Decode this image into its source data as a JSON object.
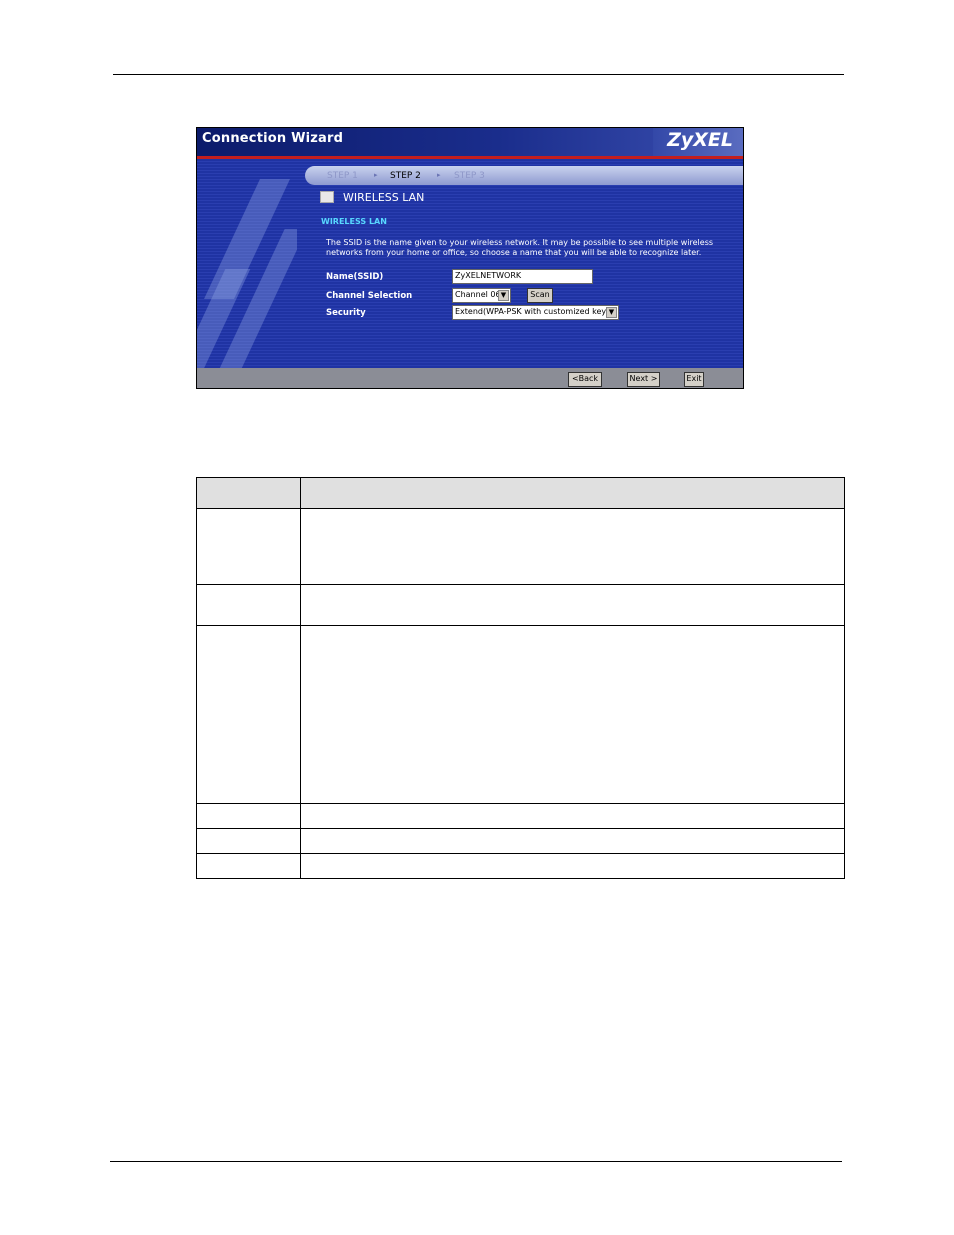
{
  "wizard": {
    "title": "Connection Wizard",
    "logo_text": "ZyXEL",
    "steps": [
      "STEP 1",
      "STEP 2",
      "STEP 3"
    ],
    "step_separator": "▸",
    "active_step": "STEP 2",
    "section_title": "WIRELESS LAN",
    "sub_title": "WIRELESS LAN",
    "description": "The SSID is the name given to your wireless network. It may be possible to see multiple wireless networks from your home or office, so choose a name that you will be able to recognize later.",
    "fields": {
      "ssid_label": "Name(SSID)",
      "ssid_value": "ZyXELNETWORK",
      "channel_label": "Channel Selection",
      "channel_value": "Channel 06",
      "scan_label": "Scan",
      "security_label": "Security",
      "security_value": "Extend(WPA-PSK with customized key)"
    },
    "buttons": {
      "back": "<Back",
      "next": "Next >",
      "exit": "Exit"
    },
    "colors": {
      "header": "#0c1b6b",
      "body": "#1f33a3",
      "accent_line": "#c41e1e",
      "subtitle": "#58d8ff"
    }
  },
  "table": {
    "header": [
      "",
      ""
    ],
    "rows": [
      [
        "",
        ""
      ],
      [
        "",
        ""
      ],
      [
        "",
        ""
      ],
      [
        "",
        ""
      ],
      [
        "",
        ""
      ],
      [
        "",
        ""
      ]
    ]
  }
}
